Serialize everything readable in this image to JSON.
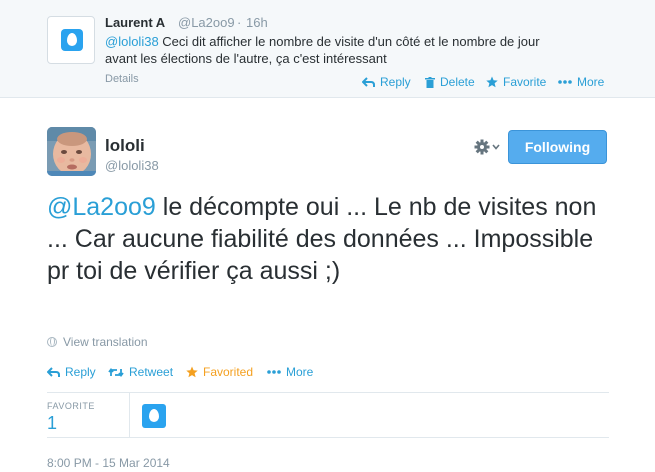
{
  "parent_tweet": {
    "name": "Laurent A",
    "handle": "@La2oo9",
    "separator": "·",
    "time": "16h",
    "mention": "@lololi38",
    "text_line1": " Ceci dit afficher le nombre de visite d'un côté et le nombre de jour",
    "text_line2": "avant les élections de l'autre, ça c'est intéressant",
    "details_label": "Details",
    "actions": {
      "reply": "Reply",
      "delete": "Delete",
      "favorite": "Favorite",
      "more": "More"
    },
    "avatar_icon": "default-egg-avatar"
  },
  "main_tweet": {
    "name": "lololi",
    "handle": "@lololi38",
    "follow_button": "Following",
    "mention": "@La2oo9",
    "text": " le décompte oui ... Le nb de visites non ... Car aucune fiabilité des données ... Impossible pr toi de vérifier ça aussi ;)",
    "view_translation": "View translation",
    "actions": {
      "reply": "Reply",
      "retweet": "Retweet",
      "favorited": "Favorited",
      "more": "More"
    },
    "stats": {
      "favorites_label": "FAVORITE",
      "favorites_count": "1"
    },
    "timestamp": "8:00 PM - 15 Mar 2014"
  },
  "colors": {
    "link": "#2a9fd6",
    "muted": "#8899a6",
    "follow_bg": "#55acee",
    "favorited": "#f4a020",
    "parent_bg": "#f5f8fa"
  }
}
